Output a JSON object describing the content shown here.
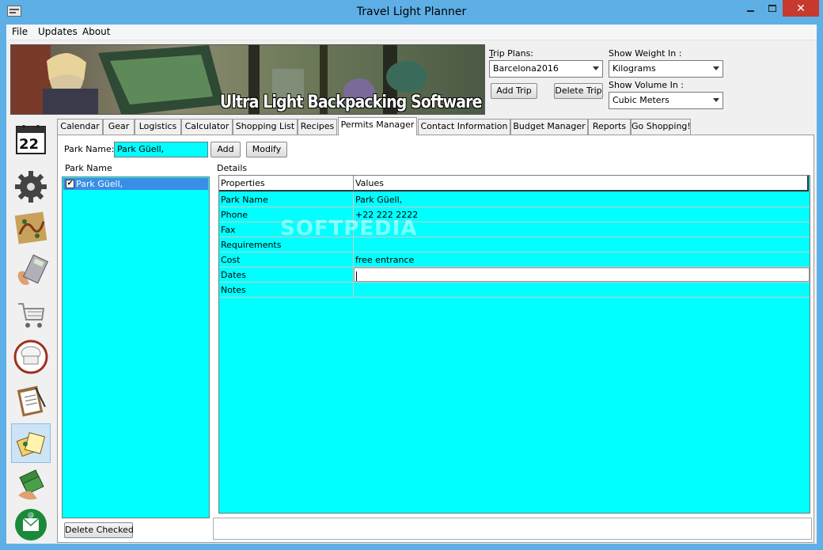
{
  "window": {
    "title": "Travel Light Planner"
  },
  "menu": [
    "File",
    "Updates",
    "About"
  ],
  "banner": {
    "text": "Ultra Light Backpacking Software"
  },
  "trip_plans": {
    "label": "Trip Plans:",
    "selected": "Barcelona2016",
    "add": "Add Trip",
    "delete": "Delete Trip"
  },
  "weight": {
    "label": "Show Weight In :",
    "selected": "Kilograms"
  },
  "volume": {
    "label": "Show Volume In :",
    "selected": "Cubic Meters"
  },
  "sidebar": [
    {
      "name": "calendar-icon",
      "text": "22"
    },
    {
      "name": "gear-icon"
    },
    {
      "name": "map-icon"
    },
    {
      "name": "calculator-icon"
    },
    {
      "name": "shopping-cart-icon"
    },
    {
      "name": "chef-hat-icon"
    },
    {
      "name": "clipboard-icon"
    },
    {
      "name": "phone-contacts-icon"
    },
    {
      "name": "money-icon"
    },
    {
      "name": "email-icon"
    }
  ],
  "tabs": [
    "Calendar",
    "Gear",
    "Logistics",
    "Calculator",
    "Shopping List",
    "Recipes",
    "Permits Manager",
    "Contact Information",
    "Budget Manager",
    "Reports",
    "Go Shopping!"
  ],
  "active_tab": "Permits Manager",
  "park_form": {
    "label": "Park Name:",
    "value": "Park Güell,",
    "add": "Add",
    "modify": "Modify"
  },
  "park_list": {
    "title": "Park Name",
    "items": [
      {
        "label": "Park Güell,",
        "checked": true
      }
    ],
    "delete_checked": "Delete Checked"
  },
  "details": {
    "title": "Details",
    "headers": [
      "Properties",
      "Values"
    ],
    "rows": [
      {
        "property": "Park Name",
        "value": "Park Güell,"
      },
      {
        "property": "Phone",
        "value": "+22 222 2222"
      },
      {
        "property": "Fax",
        "value": ""
      },
      {
        "property": "Requirements",
        "value": ""
      },
      {
        "property": "Cost",
        "value": "free entrance"
      },
      {
        "property": "Dates",
        "value": ""
      },
      {
        "property": "Notes",
        "value": ""
      }
    ]
  },
  "watermark": "SOFTPEDIA",
  "colors": {
    "cyan": "#00ffff",
    "selection": "#3a8ee6",
    "window_frame": "#5dafe6",
    "close_button": "#c7392d"
  }
}
